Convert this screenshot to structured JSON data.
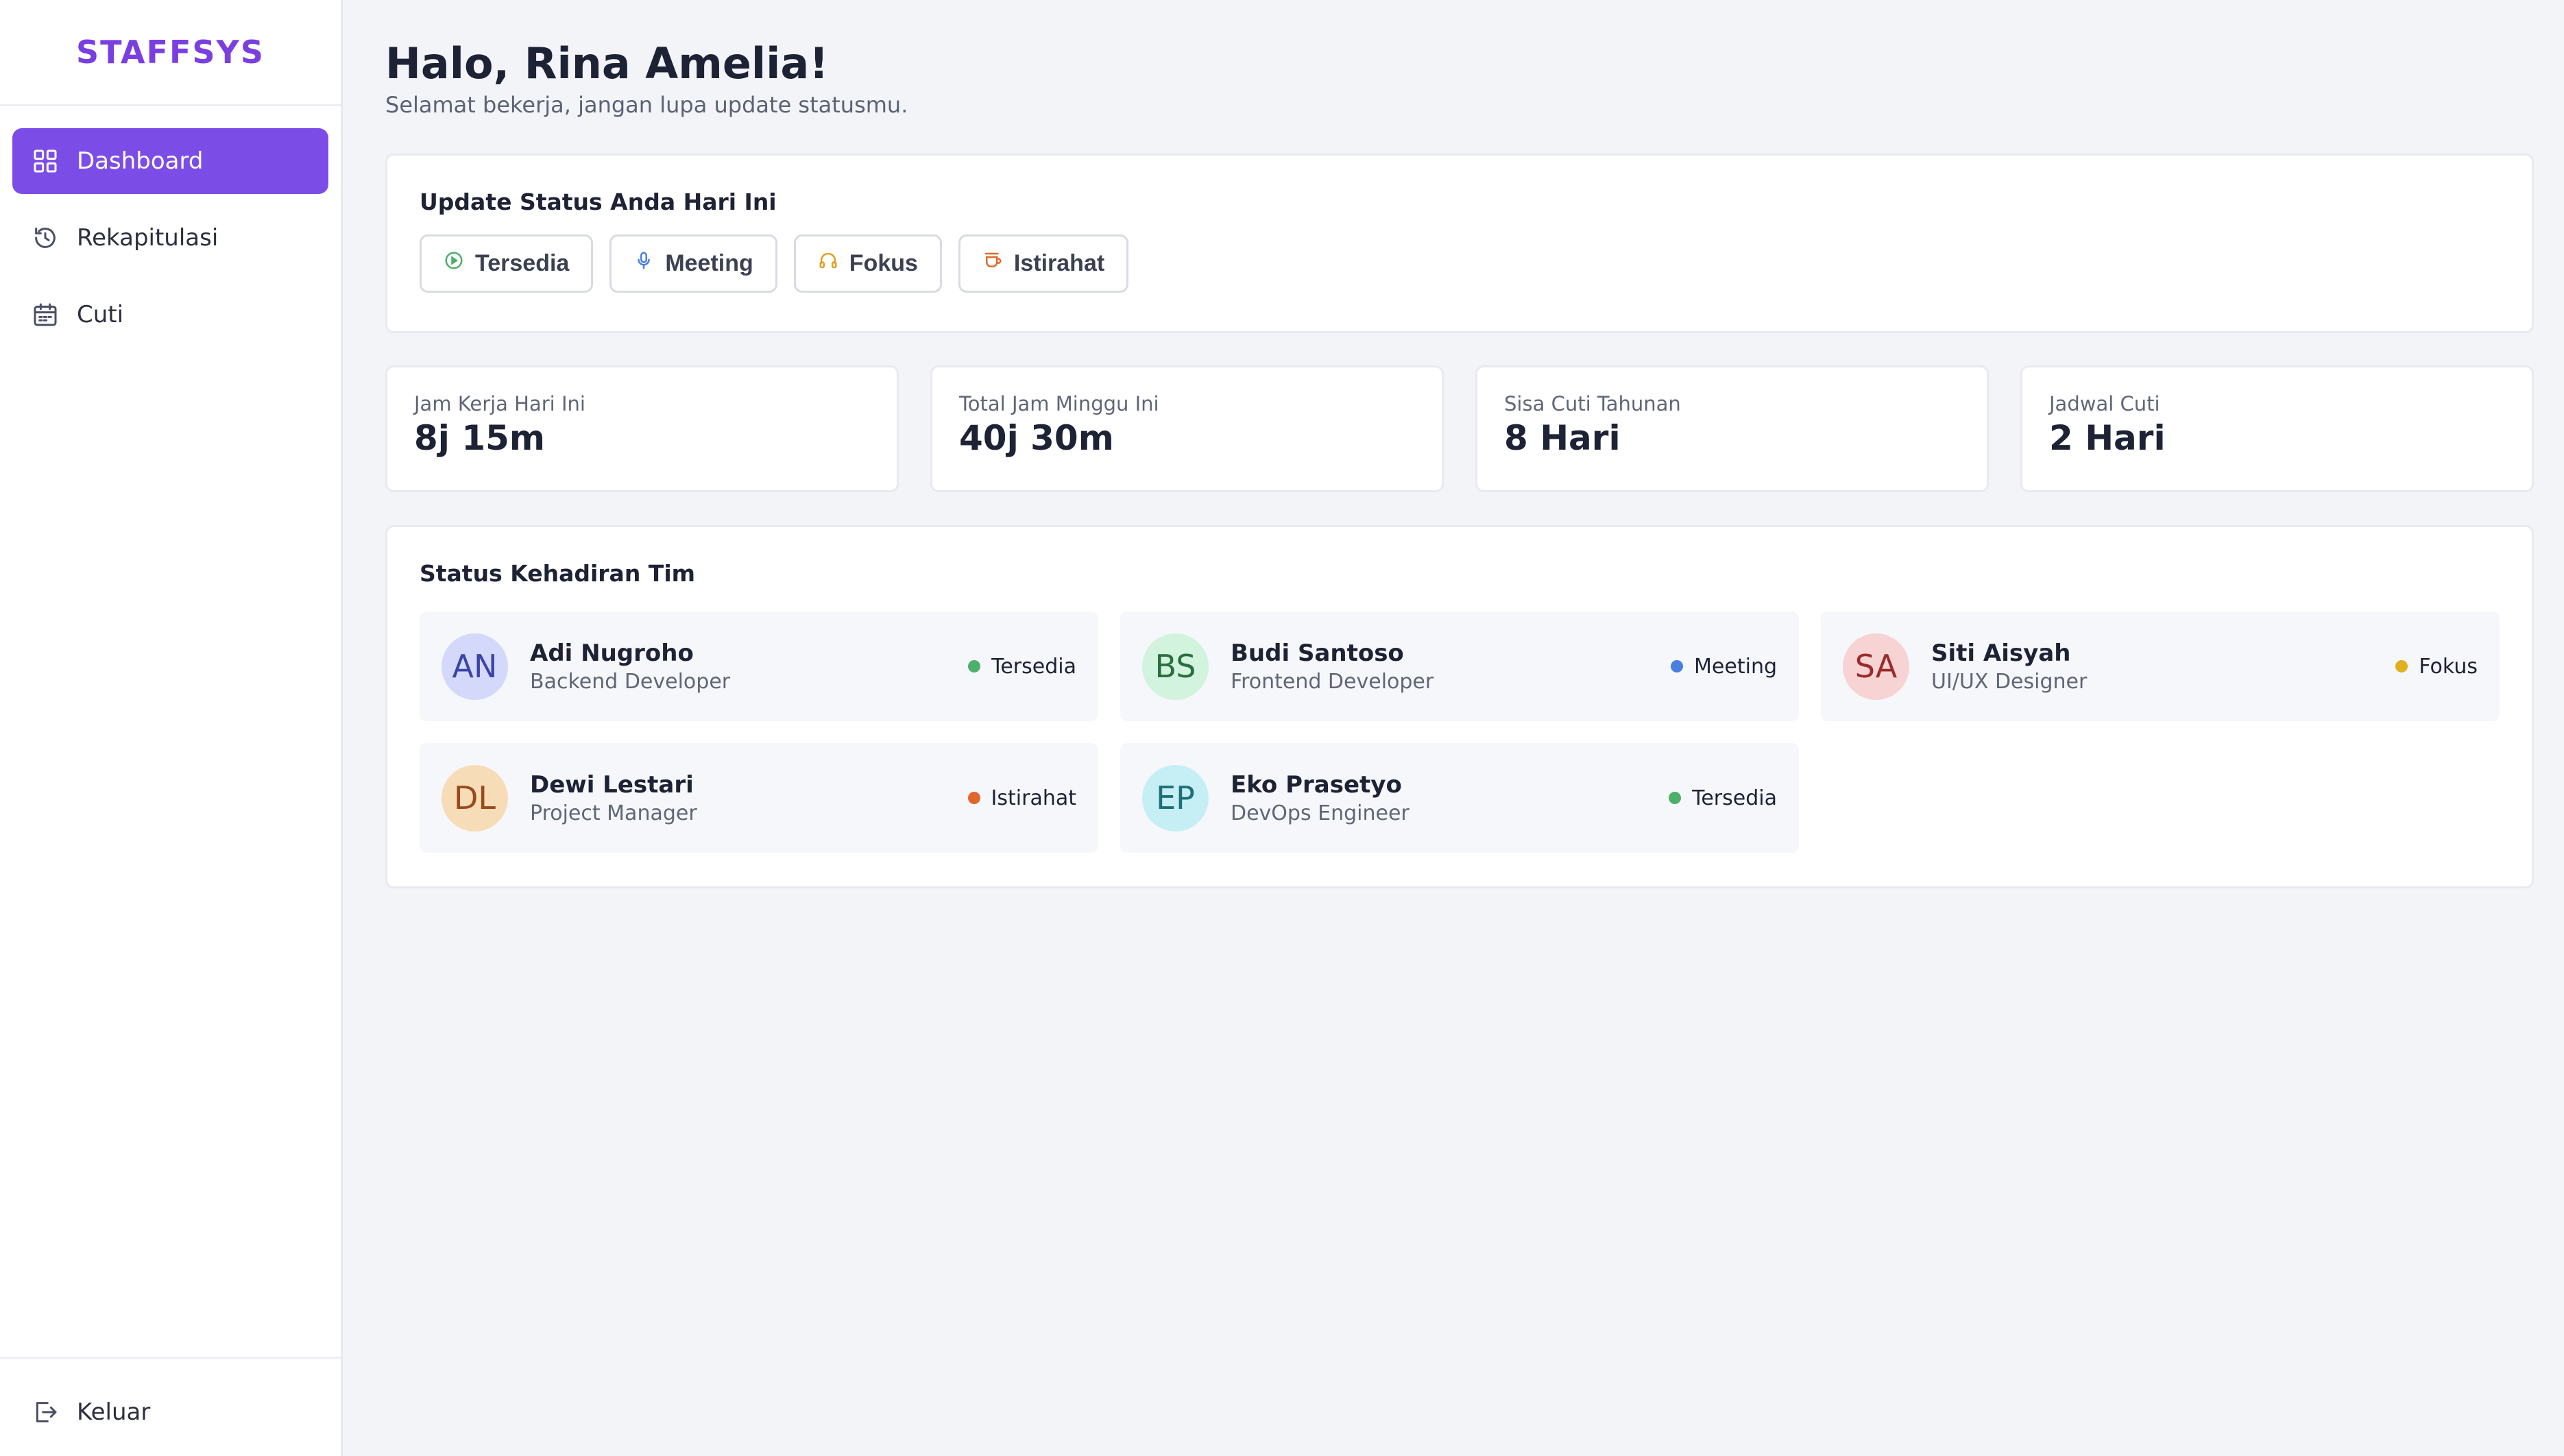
{
  "app": {
    "brand": "STAFFSYS"
  },
  "sidebar": {
    "items": [
      {
        "label": "Dashboard",
        "icon": "grid-icon",
        "active": true
      },
      {
        "label": "Rekapitulasi",
        "icon": "clock-history-icon",
        "active": false
      },
      {
        "label": "Cuti",
        "icon": "calendar-icon",
        "active": false
      }
    ],
    "logout": {
      "label": "Keluar",
      "icon": "logout-icon"
    }
  },
  "header": {
    "greeting": "Halo, Rina Amelia!",
    "subtitle": "Selamat bekerja, jangan lupa update statusmu."
  },
  "status_update": {
    "title": "Update Status Anda Hari Ini",
    "buttons": [
      {
        "label": "Tersedia",
        "icon": "play-circle-icon",
        "color": "#4caf6a"
      },
      {
        "label": "Meeting",
        "icon": "microphone-icon",
        "color": "#4a7fe0"
      },
      {
        "label": "Fokus",
        "icon": "headphones-icon",
        "color": "#e0a020"
      },
      {
        "label": "Istirahat",
        "icon": "coffee-icon",
        "color": "#e06a2c"
      }
    ]
  },
  "stats": [
    {
      "label": "Jam Kerja Hari Ini",
      "value": "8j 15m"
    },
    {
      "label": "Total Jam Minggu Ini",
      "value": "40j 30m"
    },
    {
      "label": "Sisa Cuti Tahunan",
      "value": "8 Hari"
    },
    {
      "label": "Jadwal Cuti",
      "value": "2 Hari"
    }
  ],
  "team": {
    "title": "Status Kehadiran Tim",
    "members": [
      {
        "initials": "AN",
        "name": "Adi Nugroho",
        "role": "Backend Developer",
        "status": "Tersedia",
        "status_color": "#4caf6a",
        "avatar_bg": "#d4d9fb",
        "avatar_fg": "#3b45a8"
      },
      {
        "initials": "BS",
        "name": "Budi Santoso",
        "role": "Frontend Developer",
        "status": "Meeting",
        "status_color": "#4a7fe0",
        "avatar_bg": "#d2f3dd",
        "avatar_fg": "#2a6e3d"
      },
      {
        "initials": "SA",
        "name": "Siti Aisyah",
        "role": "UI/UX Designer",
        "status": "Fokus",
        "status_color": "#e0b020",
        "avatar_bg": "#f7d3d3",
        "avatar_fg": "#9a2c2c"
      },
      {
        "initials": "DL",
        "name": "Dewi Lestari",
        "role": "Project Manager",
        "status": "Istirahat",
        "status_color": "#e0662c",
        "avatar_bg": "#f7dcb8",
        "avatar_fg": "#9a4a1c"
      },
      {
        "initials": "EP",
        "name": "Eko Prasetyo",
        "role": "DevOps Engineer",
        "status": "Tersedia",
        "status_color": "#4caf6a",
        "avatar_bg": "#c6eff5",
        "avatar_fg": "#1e6f7a"
      }
    ]
  }
}
